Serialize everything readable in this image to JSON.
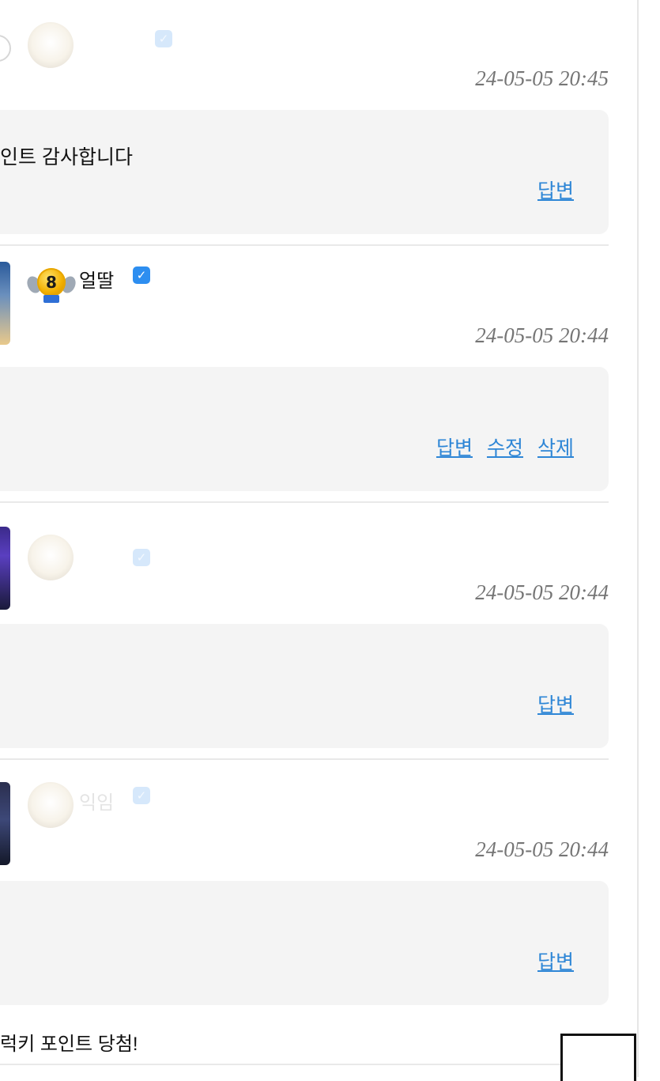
{
  "comments": [
    {
      "nickname": "",
      "timestamp": "24-05-05 20:45",
      "text": "인트 감사합니다",
      "actions": [
        "답변"
      ]
    },
    {
      "level": "8",
      "nickname": "얼딸",
      "timestamp": "24-05-05 20:44",
      "text": "",
      "actions": [
        "답변",
        "수정",
        "삭제"
      ]
    },
    {
      "nickname": "",
      "timestamp": "24-05-05 20:44",
      "text": "",
      "actions": [
        "답변"
      ]
    },
    {
      "nickname": "익임",
      "timestamp": "24-05-05 20:44",
      "text": "",
      "actions": [
        "답변"
      ]
    }
  ],
  "footer": {
    "text": "럭키 포인트 당첨!"
  },
  "icons": {
    "verified": "checkbox-checked-icon",
    "level": "level-badge-icon"
  },
  "colors": {
    "link": "#2e86d6",
    "verified": "#2d8ef0",
    "bubble": "#f4f4f4",
    "timestamp": "#757575"
  }
}
